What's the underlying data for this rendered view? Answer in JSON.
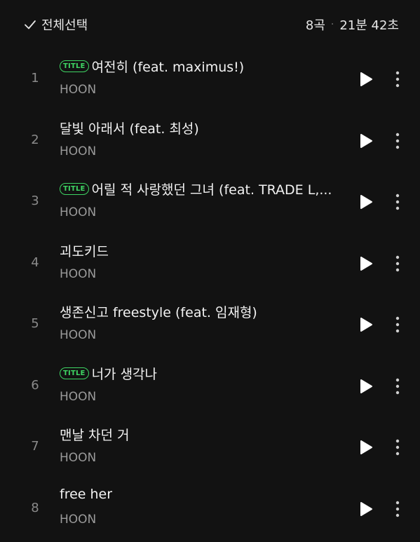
{
  "header": {
    "select_all_label": "전체선택",
    "track_count": "8곡",
    "separator": "·",
    "total_duration": "21분 42초"
  },
  "badge_label": "TITLE",
  "colors": {
    "accent": "#3ed463",
    "background": "#121212"
  },
  "tracks": [
    {
      "number": "1",
      "title": "여전히 (feat. maximus!)",
      "artist": "HOON",
      "is_title": true
    },
    {
      "number": "2",
      "title": "달빛 아래서 (feat. 최성)",
      "artist": "HOON",
      "is_title": false
    },
    {
      "number": "3",
      "title": "어릴 적 사랑했던 그녀 (feat. TRADE L,...",
      "artist": "HOON",
      "is_title": true
    },
    {
      "number": "4",
      "title": "괴도키드",
      "artist": "HOON",
      "is_title": false
    },
    {
      "number": "5",
      "title": "생존신고 freestyle (feat. 임재형)",
      "artist": "HOON",
      "is_title": false
    },
    {
      "number": "6",
      "title": "너가 생각나",
      "artist": "HOON",
      "is_title": true
    },
    {
      "number": "7",
      "title": "맨날 차던 거",
      "artist": "HOON",
      "is_title": false
    },
    {
      "number": "8",
      "title": "free her",
      "artist": "HOON",
      "is_title": false
    }
  ]
}
